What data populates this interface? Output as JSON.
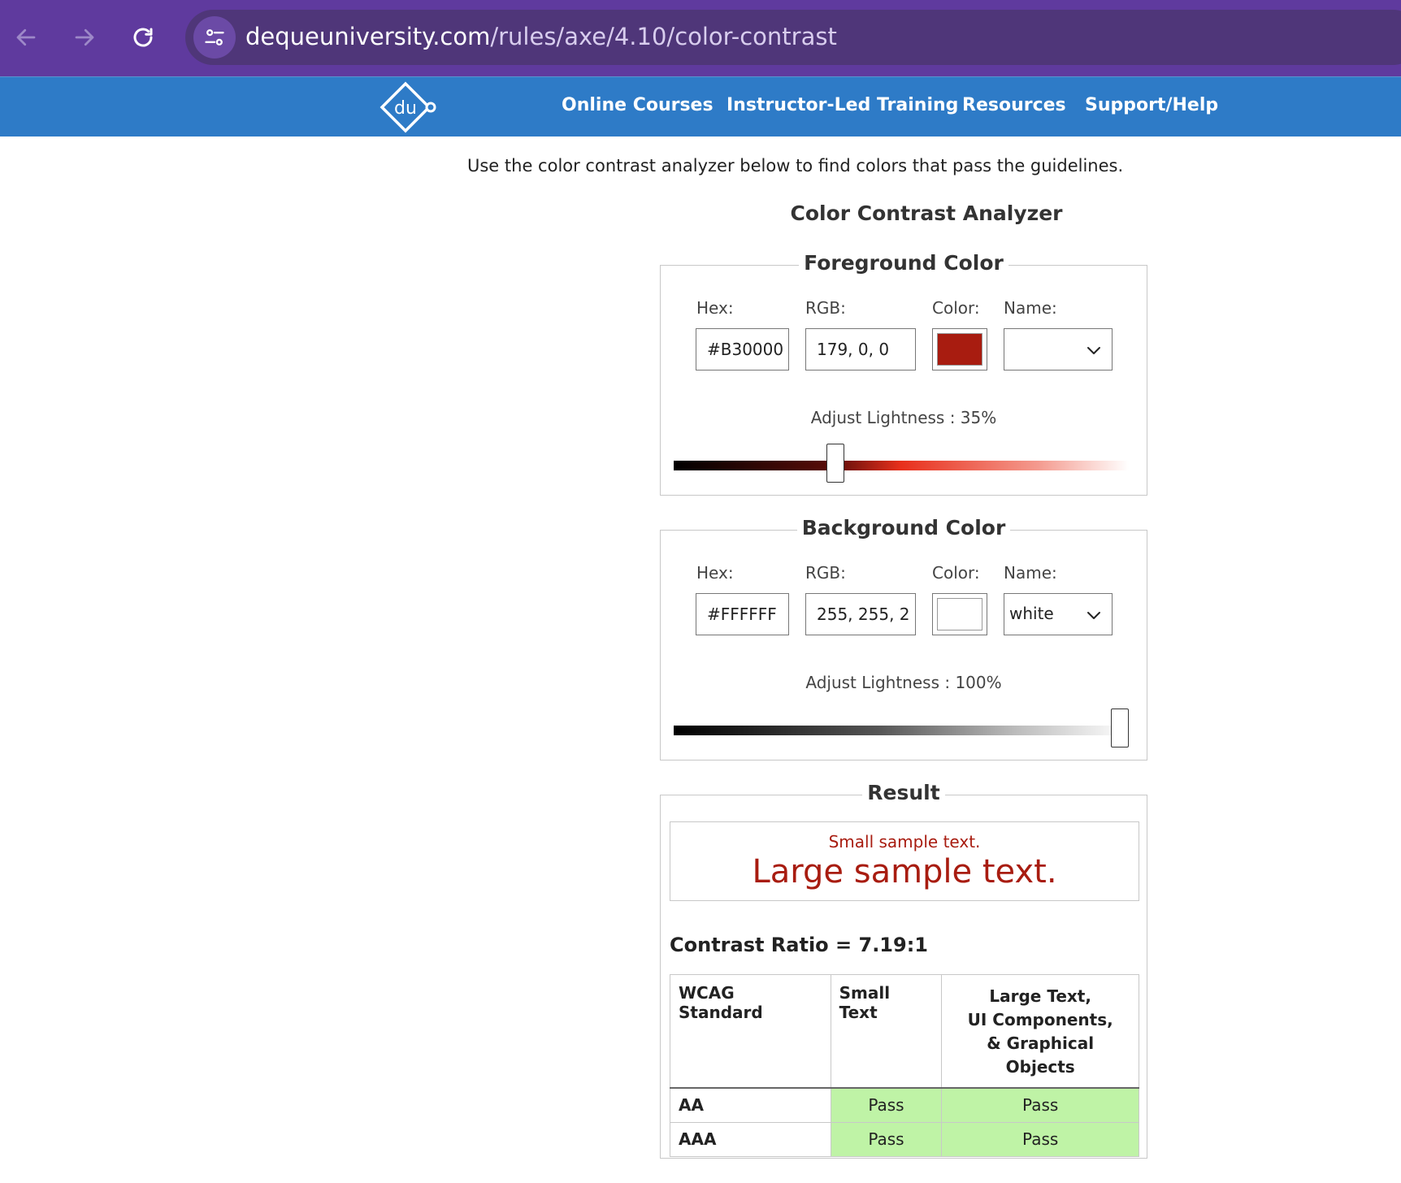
{
  "browser": {
    "url_domain": "dequeuniversity.com",
    "url_path": "/rules/axe/4.10/color-contrast",
    "back_icon": "arrow-left-icon",
    "forward_icon": "arrow-right-icon",
    "reload_icon": "reload-icon",
    "site_info_icon": "tune-icon"
  },
  "header": {
    "logo_text": "du",
    "nav": [
      "Online Courses",
      "Instructor-Led Training",
      "Resources",
      "Support/Help"
    ]
  },
  "intro": "Use the color contrast analyzer below to find colors that pass the guidelines.",
  "analyzer_title": "Color Contrast Analyzer",
  "foreground": {
    "legend": "Foreground Color",
    "hex_label": "Hex:",
    "rgb_label": "RGB:",
    "color_label": "Color:",
    "name_label": "Name:",
    "hex": "#B30000",
    "rgb": "179, 0, 0",
    "swatch_color": "#a81c10",
    "name": "",
    "adjust_label": "Adjust Lightness : 35%",
    "lightness": 0.35
  },
  "background": {
    "legend": "Background Color",
    "hex_label": "Hex:",
    "rgb_label": "RGB:",
    "color_label": "Color:",
    "name_label": "Name:",
    "hex": "#FFFFFF",
    "rgb": "255, 255, 2",
    "swatch_color": "#ffffff",
    "name": "white",
    "adjust_label": "Adjust Lightness : 100%",
    "lightness": 1.0
  },
  "result": {
    "legend": "Result",
    "small_sample": "Small sample text.",
    "large_sample": "Large sample text.",
    "sample_color": "#a81c10",
    "contrast_ratio": "Contrast Ratio = 7.19:1",
    "table": {
      "headers": [
        "WCAG Standard",
        "Small Text",
        "Large Text,\nUI Components,\n& Graphical Objects"
      ],
      "rows": [
        {
          "standard": "AA",
          "small": "Pass",
          "large": "Pass"
        },
        {
          "standard": "AAA",
          "small": "Pass",
          "large": "Pass"
        }
      ],
      "pass_color": "#bff3a6"
    }
  },
  "colors": {
    "chrome": "#5f3a9e",
    "header": "#2e7bc7"
  }
}
